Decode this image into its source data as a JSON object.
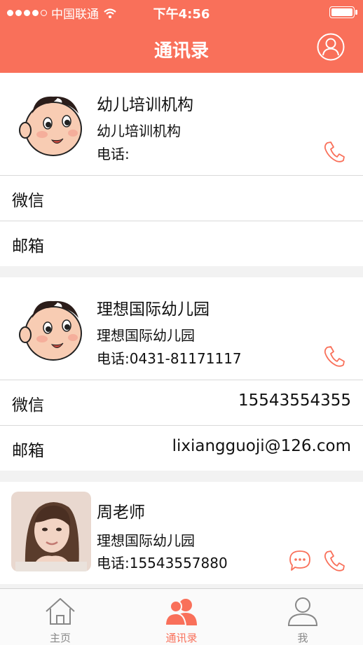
{
  "status_bar": {
    "carrier": "中国联通",
    "time": "下午4:56"
  },
  "nav": {
    "title": "通讯录"
  },
  "contacts": [
    {
      "name": "幼儿培训机构",
      "org": "幼儿培训机构",
      "phone": "电话:",
      "wechat_label": "微信",
      "wechat": "",
      "email_label": "邮箱",
      "email": ""
    },
    {
      "name": "理想国际幼儿园",
      "org": "理想国际幼儿园",
      "phone": "电话:0431-81171117",
      "wechat_label": "微信",
      "wechat": "15543554355",
      "email_label": "邮箱",
      "email": "lixiangguoji@126.com"
    },
    {
      "name": "周老师",
      "org": "理想国际幼儿园",
      "phone": "电话:15543557880"
    }
  ],
  "tabs": [
    {
      "label": "主页",
      "icon": "home-icon"
    },
    {
      "label": "通讯录",
      "icon": "contacts-icon"
    },
    {
      "label": "我",
      "icon": "profile-icon"
    }
  ],
  "colors": {
    "accent": "#f9705a",
    "inactive": "#888888"
  }
}
